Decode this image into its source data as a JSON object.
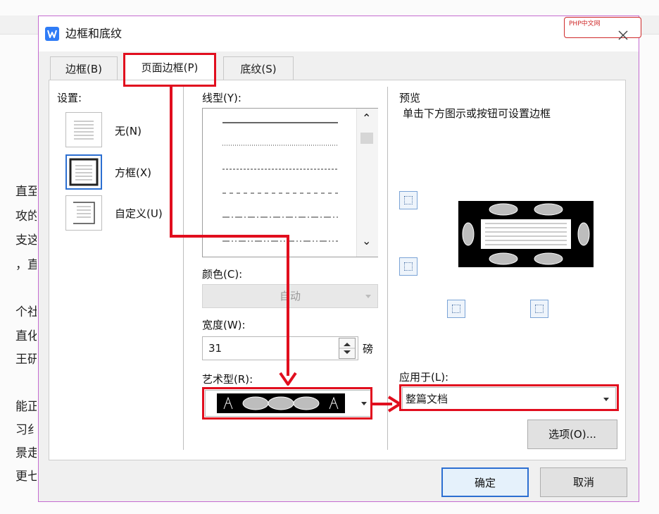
{
  "dialog": {
    "title": "边框和底纹",
    "close_glyph": "✕",
    "watermark": "PHP中文网"
  },
  "tabs": [
    {
      "label": "边框(B)"
    },
    {
      "label": "页面边框(P)"
    },
    {
      "label": "底纹(S)"
    }
  ],
  "settings": {
    "heading": "设置:",
    "options": [
      {
        "label": "无(N)"
      },
      {
        "label": "方框(X)"
      },
      {
        "label": "自定义(U)"
      }
    ]
  },
  "line_style": {
    "label": "线型(Y):",
    "scroll_up": "⌃",
    "scroll_down": "⌄"
  },
  "color": {
    "label": "颜色(C):",
    "value": "自动"
  },
  "width": {
    "label": "宽度(W):",
    "value": "31",
    "unit": "磅"
  },
  "art": {
    "label": "艺术型(R):"
  },
  "preview": {
    "heading": "预览",
    "hint": "单击下方图示或按钮可设置边框"
  },
  "apply_to": {
    "label": "应用于(L):",
    "value": "整篇文档"
  },
  "buttons": {
    "options": "选项(O)...",
    "ok": "确定",
    "cancel": "取消"
  },
  "background_doc": {
    "lines": [
      {
        "text": "直至"
      },
      {
        "text": "攻的"
      },
      {
        "text": "支这"
      },
      {
        "text": "，直"
      },
      {
        "text": "个社"
      },
      {
        "text": "直化"
      },
      {
        "text": "王研"
      },
      {
        "text": "能正"
      },
      {
        "text": "习纟"
      },
      {
        "text": "景走"
      },
      {
        "text": "更七"
      }
    ]
  },
  "colors": {
    "highlight_red": "#e10e1e",
    "dialog_border": "#c46bd0",
    "app_icon_blue": "#2f7cf6"
  }
}
